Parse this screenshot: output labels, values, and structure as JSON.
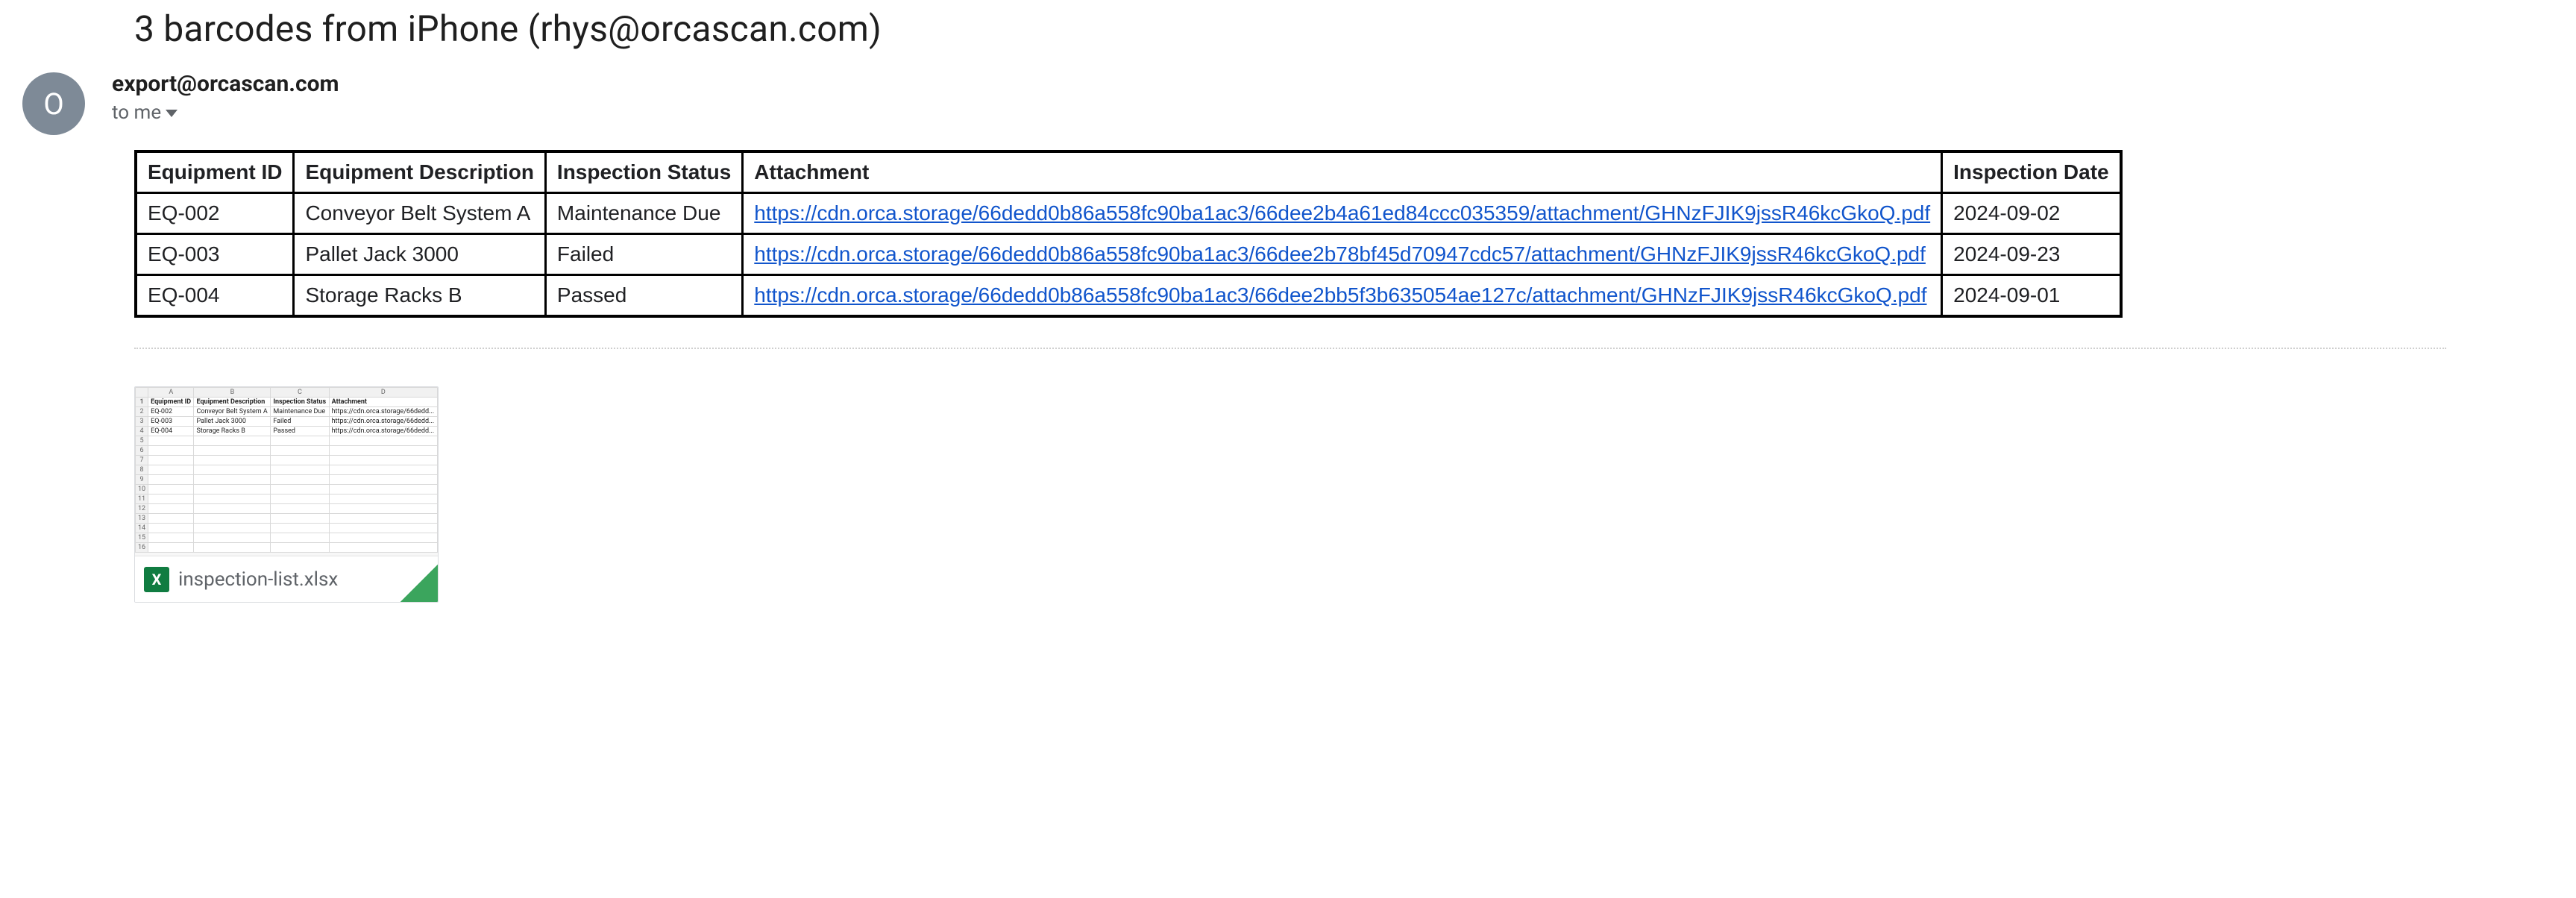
{
  "subject": "3 barcodes from iPhone (rhys@orcascan.com)",
  "avatar_initial": "O",
  "sender": "export@orcascan.com",
  "recipient_label": "to me",
  "table": {
    "headers": [
      "Equipment ID",
      "Equipment Description",
      "Inspection Status",
      "Attachment",
      "Inspection Date"
    ],
    "rows": [
      {
        "id": "EQ-002",
        "desc": "Conveyor Belt System A",
        "status": "Maintenance Due",
        "link": "https://cdn.orca.storage/66dedd0b86a558fc90ba1ac3/66dee2b4a61ed84ccc035359/attachment/GHNzFJIK9jssR46kcGkoQ.pdf",
        "date": "2024-09-02"
      },
      {
        "id": "EQ-003",
        "desc": "Pallet Jack 3000",
        "status": "Failed",
        "link": "https://cdn.orca.storage/66dedd0b86a558fc90ba1ac3/66dee2b78bf45d70947cdc57/attachment/GHNzFJIK9jssR46kcGkoQ.pdf",
        "date": "2024-09-23"
      },
      {
        "id": "EQ-004",
        "desc": "Storage Racks B",
        "status": "Passed",
        "link": "https://cdn.orca.storage/66dedd0b86a558fc90ba1ac3/66dee2bb5f3b635054ae127c/attachment/GHNzFJIK9jssR46kcGkoQ.pdf",
        "date": "2024-09-01"
      }
    ]
  },
  "attachment": {
    "filename": "inspection-list.xlsx",
    "icon_letter": "X",
    "preview_cols": [
      "A",
      "B",
      "C",
      "D"
    ],
    "preview_headers": [
      "Equipment ID",
      "Equipment Description",
      "Inspection Status",
      "Attachment"
    ],
    "preview_rows": [
      [
        "EQ-002",
        "Conveyor Belt System A",
        "Maintenance Due",
        "https://cdn.orca.storage/66dedd..."
      ],
      [
        "EQ-003",
        "Pallet Jack 3000",
        "Failed",
        "https://cdn.orca.storage/66dedd..."
      ],
      [
        "EQ-004",
        "Storage Racks B",
        "Passed",
        "https://cdn.orca.storage/66dedd..."
      ]
    ]
  }
}
